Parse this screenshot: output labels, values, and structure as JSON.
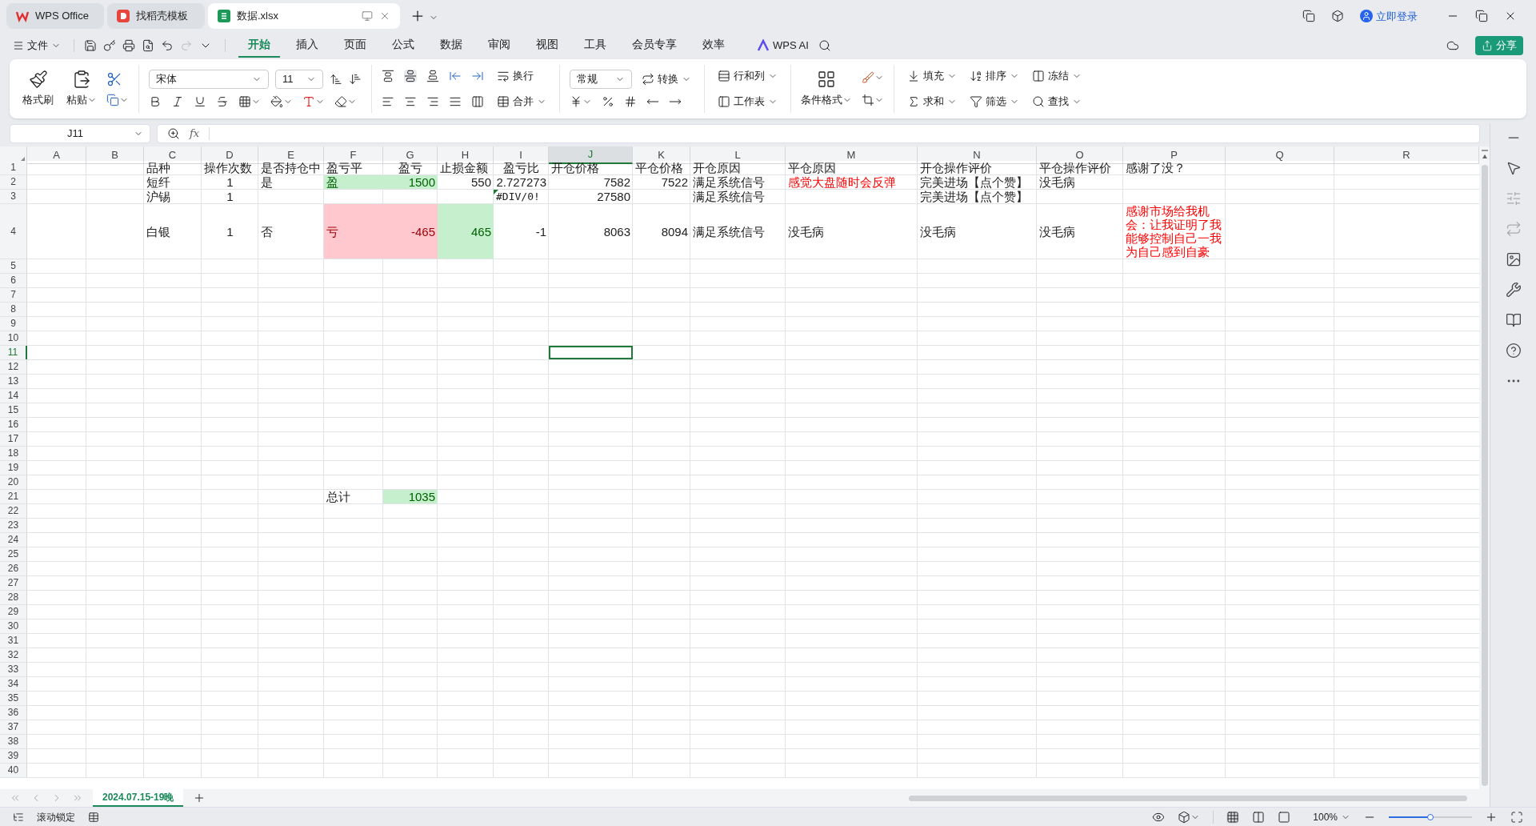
{
  "window_tabs": [
    {
      "label": "WPS Office",
      "selected": false,
      "kind": "wps"
    },
    {
      "label": "找稻壳模板",
      "selected": false,
      "kind": "docer"
    },
    {
      "label": "数据.xlsx",
      "selected": true,
      "kind": "sheet"
    }
  ],
  "account": {
    "label": "立即登录"
  },
  "menu": {
    "file": "文件",
    "tabs": [
      {
        "label": "开始",
        "selected": true
      },
      {
        "label": "插入",
        "selected": false
      },
      {
        "label": "页面",
        "selected": false
      },
      {
        "label": "公式",
        "selected": false
      },
      {
        "label": "数据",
        "selected": false
      },
      {
        "label": "审阅",
        "selected": false
      },
      {
        "label": "视图",
        "selected": false
      },
      {
        "label": "工具",
        "selected": false
      },
      {
        "label": "会员专享",
        "selected": false
      },
      {
        "label": "效率",
        "selected": false
      }
    ],
    "ai": "WPS AI",
    "share": "分享"
  },
  "ribbon": {
    "format_painter": "格式刷",
    "paste": "粘贴",
    "font": "宋体",
    "size": "11",
    "wrap": "换行",
    "merge": "合并",
    "number_format": "常规",
    "convert": "转换",
    "rows_cols": "行和列",
    "worksheet": "工作表",
    "cond_format": "条件格式",
    "fill": "填充",
    "sort": "排序",
    "freeze": "冻结",
    "sum": "求和",
    "filter": "筛选",
    "find": "查找"
  },
  "formula_bar": {
    "name_box": "J11",
    "fx": "fx"
  },
  "columns": [
    {
      "label": "A",
      "selected": false
    },
    {
      "label": "B",
      "selected": false
    },
    {
      "label": "C",
      "selected": false
    },
    {
      "label": "D",
      "selected": false
    },
    {
      "label": "E",
      "selected": false
    },
    {
      "label": "F",
      "selected": false
    },
    {
      "label": "G",
      "selected": false
    },
    {
      "label": "H",
      "selected": false
    },
    {
      "label": "I",
      "selected": false
    },
    {
      "label": "J",
      "selected": true
    },
    {
      "label": "K",
      "selected": false
    },
    {
      "label": "L",
      "selected": false
    },
    {
      "label": "M",
      "selected": false
    },
    {
      "label": "N",
      "selected": false
    },
    {
      "label": "O",
      "selected": false
    },
    {
      "label": "P",
      "selected": false
    },
    {
      "label": "Q",
      "selected": false
    },
    {
      "label": "R",
      "selected": false
    }
  ],
  "rows": [
    {
      "number": "1",
      "selected": false,
      "cells": [
        null,
        null,
        {
          "text": "品种",
          "kind": "text"
        },
        {
          "text": "操作次数",
          "kind": "text"
        },
        {
          "text": "是否持仓中",
          "kind": "text"
        },
        {
          "text": "盈亏平",
          "kind": "text"
        },
        {
          "text": "盈亏",
          "kind": "count"
        },
        {
          "text": "止损金额",
          "kind": "text"
        },
        {
          "text": "盈亏比",
          "kind": "count"
        },
        {
          "text": "开仓价格",
          "kind": "text"
        },
        {
          "text": "平仓价格",
          "kind": "text"
        },
        {
          "text": "开仓原因",
          "kind": "text"
        },
        {
          "text": "平仓原因",
          "kind": "text"
        },
        {
          "text": "开仓操作评价",
          "kind": "text"
        },
        {
          "text": "平仓操作评价",
          "kind": "text"
        },
        {
          "text": "感谢了没？",
          "kind": "text"
        }
      ]
    },
    {
      "number": "2",
      "selected": false,
      "cells": [
        null,
        null,
        {
          "text": "短纤",
          "kind": "text"
        },
        {
          "text": "1",
          "kind": "count"
        },
        {
          "text": "是",
          "kind": "text"
        },
        {
          "text": "盈",
          "kind": "gain-label"
        },
        {
          "text": "1500",
          "kind": "gain"
        },
        {
          "text": "550",
          "kind": "number"
        },
        {
          "text": "2.727273",
          "kind": "number"
        },
        {
          "text": "7582",
          "kind": "number"
        },
        {
          "text": "7522",
          "kind": "number"
        },
        {
          "text": "满足系统信号",
          "kind": "text"
        },
        {
          "text": "感觉大盘随时会反弹",
          "kind": "warn"
        },
        {
          "text": "完美进场【点个赞】",
          "kind": "text"
        },
        {
          "text": "没毛病",
          "kind": "text"
        }
      ]
    },
    {
      "number": "3",
      "selected": false,
      "cells": [
        null,
        null,
        {
          "text": "沪锡",
          "kind": "text"
        },
        {
          "text": "1",
          "kind": "count"
        },
        null,
        null,
        null,
        null,
        {
          "text": "#DIV/0!",
          "kind": "error"
        },
        {
          "text": "27580",
          "kind": "number"
        },
        null,
        {
          "text": "满足系统信号",
          "kind": "text"
        },
        null,
        {
          "text": "完美进场【点个赞】",
          "kind": "text"
        }
      ]
    },
    {
      "number": "4",
      "selected": false,
      "cells": [
        null,
        null,
        {
          "text": "白银",
          "kind": "text"
        },
        {
          "text": "1",
          "kind": "count"
        },
        {
          "text": "否",
          "kind": "text"
        },
        {
          "text": "亏",
          "kind": "loss-label"
        },
        {
          "text": "-465",
          "kind": "loss"
        },
        {
          "text": "465",
          "kind": "gain"
        },
        {
          "text": "-1",
          "kind": "number"
        },
        {
          "text": "8063",
          "kind": "number"
        },
        {
          "text": "8094",
          "kind": "number"
        },
        {
          "text": "满足系统信号",
          "kind": "text"
        },
        {
          "text": "没毛病",
          "kind": "text"
        },
        {
          "text": "没毛病",
          "kind": "text"
        },
        {
          "text": "没毛病",
          "kind": "text"
        },
        {
          "text": "感谢市场给我机会：让我证明了我能够控制自己一我为自己感到自豪",
          "kind": "warn"
        }
      ]
    },
    {
      "number": "5",
      "selected": false
    },
    {
      "number": "6",
      "selected": false
    },
    {
      "number": "7",
      "selected": false
    },
    {
      "number": "8",
      "selected": false
    },
    {
      "number": "9",
      "selected": false
    },
    {
      "number": "10",
      "selected": false
    },
    {
      "number": "11",
      "selected": true
    },
    {
      "number": "12",
      "selected": false
    },
    {
      "number": "13",
      "selected": false
    },
    {
      "number": "14",
      "selected": false
    },
    {
      "number": "15",
      "selected": false
    },
    {
      "number": "16",
      "selected": false
    },
    {
      "number": "17",
      "selected": false
    },
    {
      "number": "18",
      "selected": false
    },
    {
      "number": "19",
      "selected": false
    },
    {
      "number": "20",
      "selected": false
    },
    {
      "number": "21",
      "selected": false,
      "cells": [
        null,
        null,
        null,
        null,
        null,
        {
          "text": "总计",
          "kind": "text"
        },
        {
          "text": "1035",
          "kind": "gain"
        }
      ]
    },
    {
      "number": "22",
      "selected": false
    },
    {
      "number": "23",
      "selected": false
    },
    {
      "number": "24",
      "selected": false
    },
    {
      "number": "25",
      "selected": false
    },
    {
      "number": "26",
      "selected": false
    },
    {
      "number": "27",
      "selected": false
    },
    {
      "number": "28",
      "selected": false
    },
    {
      "number": "29",
      "selected": false
    },
    {
      "number": "30",
      "selected": false
    },
    {
      "number": "31",
      "selected": false
    },
    {
      "number": "32",
      "selected": false
    },
    {
      "number": "33",
      "selected": false
    },
    {
      "number": "34",
      "selected": false
    },
    {
      "number": "35",
      "selected": false
    },
    {
      "number": "36",
      "selected": false
    },
    {
      "number": "37",
      "selected": false
    },
    {
      "number": "38",
      "selected": false
    },
    {
      "number": "39",
      "selected": false
    },
    {
      "number": "40",
      "selected": false
    }
  ],
  "sheet_tabs": [
    {
      "label": "2024.07.15-19晚",
      "selected": true
    }
  ],
  "status_bar": {
    "scroll_lock": "滚动锁定",
    "zoom": "100%",
    "zoom_slider": {
      "level": 0.5
    }
  }
}
